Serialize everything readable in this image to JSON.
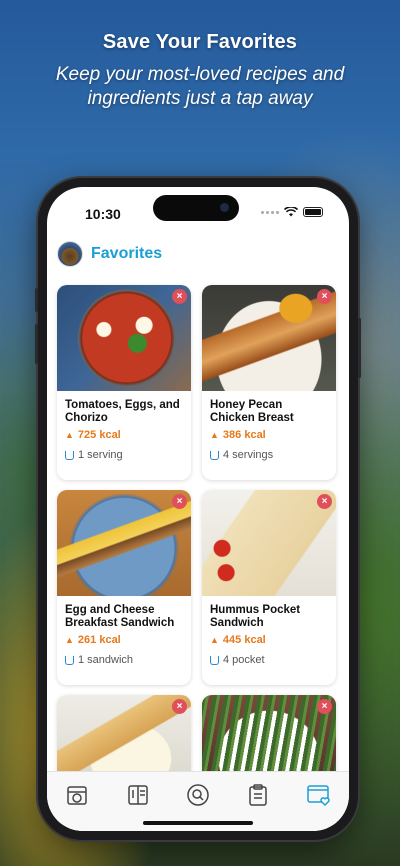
{
  "promo": {
    "title": "Save Your Favorites",
    "subtitle": "Keep your most-loved recipes and ingredients just a tap away"
  },
  "status_bar": {
    "time": "10:30"
  },
  "header": {
    "title": "Favorites",
    "title_color": "#1a9fd6"
  },
  "recipes": [
    {
      "title": "Tomatoes, Eggs, and Chorizo",
      "kcal": "725 kcal",
      "servings": "1 serving",
      "image": "shakshuka"
    },
    {
      "title": "Honey Pecan Chicken Breast",
      "kcal": "386 kcal",
      "servings": "4 servings",
      "image": "chicken"
    },
    {
      "title": "Egg and Cheese Breakfast Sandwich",
      "kcal": "261 kcal",
      "servings": "1 sandwich",
      "image": "sandwich"
    },
    {
      "title": "Hummus Pocket Sandwich",
      "kcal": "445 kcal",
      "servings": "4 pocket",
      "image": "wrap"
    },
    {
      "title": "",
      "kcal": "",
      "servings": "",
      "image": "toast"
    },
    {
      "title": "",
      "kcal": "",
      "servings": "",
      "image": "asparagus"
    }
  ],
  "remove_glyph": "×",
  "tabbar": {
    "items": [
      {
        "icon": "cooking-pot-icon",
        "active": false
      },
      {
        "icon": "recipe-book-icon",
        "active": false
      },
      {
        "icon": "search-dish-icon",
        "active": false
      },
      {
        "icon": "clipboard-list-icon",
        "active": false
      },
      {
        "icon": "favorites-icon",
        "active": true
      }
    ],
    "active_color": "#1a9fd6"
  },
  "colors": {
    "kcal": "#e6791c",
    "remove": "#e0505a"
  }
}
